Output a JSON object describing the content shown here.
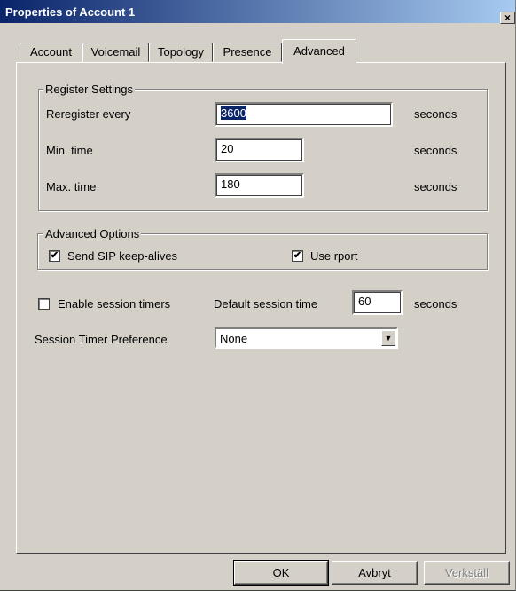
{
  "window": {
    "title": "Properties of Account 1",
    "close_label": "×"
  },
  "tabs": [
    {
      "label": "Account"
    },
    {
      "label": "Voicemail"
    },
    {
      "label": "Topology"
    },
    {
      "label": "Presence"
    },
    {
      "label": "Advanced",
      "active": true
    }
  ],
  "register": {
    "legend": "Register Settings",
    "rows": [
      {
        "label": "Reregister every",
        "value": "3600",
        "unit": "seconds"
      },
      {
        "label": "Min. time",
        "value": "20",
        "unit": "seconds"
      },
      {
        "label": "Max. time",
        "value": "180",
        "unit": "seconds"
      }
    ]
  },
  "advanced": {
    "legend": "Advanced Options",
    "keepalive_label": "Send SIP keep-alives",
    "keepalive_checked": true,
    "rport_label": "Use rport",
    "rport_checked": true
  },
  "session": {
    "enable_label": "Enable session timers",
    "enable_checked": false,
    "default_label": "Default session time",
    "default_value": "60",
    "default_unit": "seconds",
    "pref_label": "Session Timer Preference",
    "pref_value": "None"
  },
  "buttons": {
    "ok": "OK",
    "cancel": "Avbryt",
    "apply": "Verkställ"
  },
  "check_glyph": "✔",
  "arrow_glyph": "▼"
}
